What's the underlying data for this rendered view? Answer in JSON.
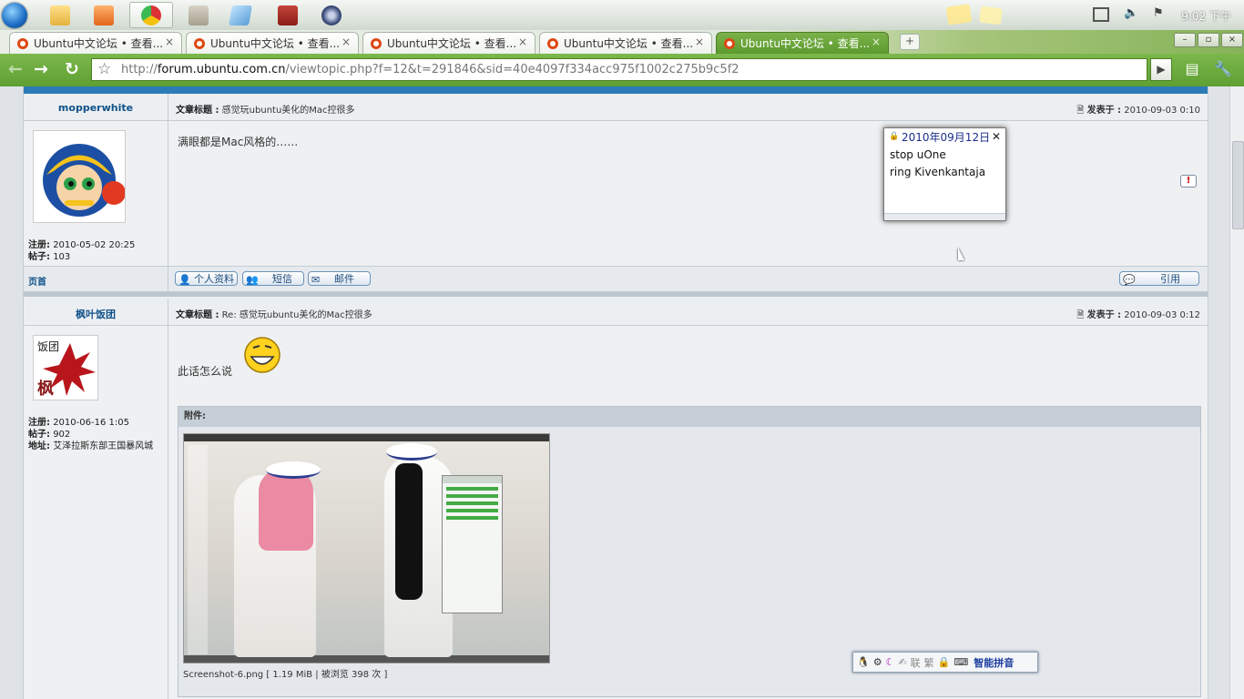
{
  "taskbar": {
    "clock": "9:02 下午",
    "icons": [
      "start-orb",
      "file-explorer-icon",
      "media-player-icon",
      "chrome-icon",
      "film-icon",
      "notes-icon",
      "dictionary-icon",
      "gear-app-icon"
    ]
  },
  "browser": {
    "tabs": [
      {
        "label": "Ubuntu中文论坛 • 查看..."
      },
      {
        "label": "Ubuntu中文论坛 • 查看..."
      },
      {
        "label": "Ubuntu中文论坛 • 查看..."
      },
      {
        "label": "Ubuntu中文论坛 • 查看..."
      },
      {
        "label": "Ubuntu中文论坛 • 查看..."
      }
    ],
    "url_scheme": "http://",
    "url_host": "forum.ubuntu.com.cn",
    "url_path": "/viewtopic.php?f=12&t=291846&sid=40e4097f334acc975f1002c275b9c5f2"
  },
  "post1": {
    "author": "mopperwhite",
    "subject_label": "文章标题 :",
    "subject": "感觉玩ubuntu美化的Mac控很多",
    "posted_label": "发表于 :",
    "posted": "2010-09-03 0:10",
    "message": "满眼都是Mac风格的……",
    "reg_label": "注册:",
    "reg": "2010-05-02 20:25",
    "posts_label": "帖子:",
    "posts": "103"
  },
  "post1_footer": {
    "top": "页首",
    "profile": "个人资料",
    "pm": "短信",
    "email": "邮件",
    "quote": "引用"
  },
  "post2": {
    "author": "枫叶饭团",
    "subject_label": "文章标题 :",
    "subject": "Re: 感觉玩ubuntu美化的Mac控很多",
    "posted_label": "发表于 :",
    "posted": "2010-09-03 0:12",
    "message": "此话怎么说",
    "reg_label": "注册:",
    "reg": "2010-06-16 1:05",
    "posts_label": "帖子:",
    "posts": "902",
    "location_label": "地址:",
    "location": "艾泽拉斯东部王国暴风城",
    "attachment_label": "附件:",
    "attachment_caption": "Screenshot-6.png [ 1.19 MiB | 被浏览 398 次 ]"
  },
  "sticky_note": {
    "date": "2010年09月12日",
    "line1": "stop uOne",
    "line2": "ring Kivenkantaja"
  },
  "ime_bar": {
    "brand": "智能拼音",
    "lian": "联",
    "fan": "繁"
  },
  "colors": {
    "chrome_green": "#6aa83c",
    "forum_blue": "#2c7bb6",
    "link_blue": "#105289"
  }
}
